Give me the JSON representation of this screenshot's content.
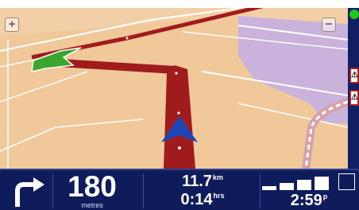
{
  "map": {
    "zoom_in_symbol": "+",
    "zoom_out_symbol": "−",
    "icons": [
      "zoom-in-icon",
      "zoom-out-icon",
      "gps-status-icon",
      "pedestrian-warning-icon",
      "position-arrow-icon",
      "destination-flag-icon"
    ],
    "colors": {
      "land": "#f0c89a",
      "water": "#c9b2dc",
      "route": "#a01b1b",
      "road": "#ffffff",
      "position_arrow": "#1c46b5",
      "destination_flag": "#3aa62e",
      "gps_ok": "#22c91b"
    }
  },
  "side_panel": {
    "warning_sign_symbol_1": "⚠",
    "warning_sign_symbol_2": "⚠"
  },
  "instruction_bar": {
    "turn_icon": "turn-right-arrow-icon",
    "distance_value": "180",
    "distance_unit": "metres",
    "remaining_distance": "11.7",
    "remaining_distance_unit": "km",
    "remaining_time": "0:14",
    "remaining_time_unit": "hrs",
    "arrival_time": "2:59",
    "arrival_suffix": "p",
    "signal_level": 4,
    "signal_max": 5,
    "colors": {
      "bar_background": "#0e1c5c",
      "text": "#ffffff"
    }
  }
}
